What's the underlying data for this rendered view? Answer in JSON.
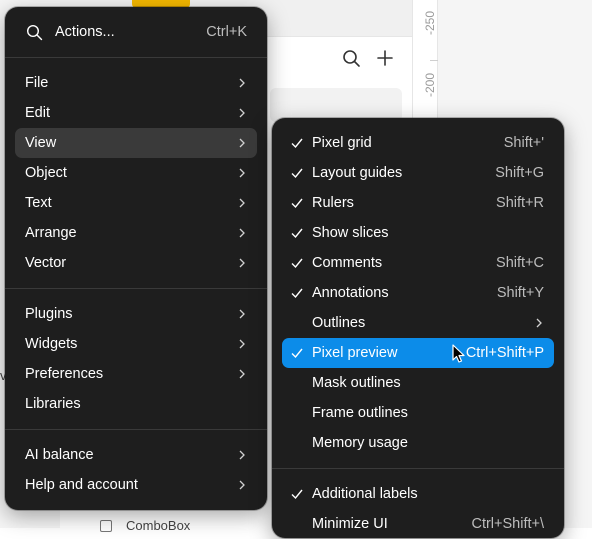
{
  "background": {
    "ruler_labels": [
      "-250",
      "-200"
    ],
    "bottom_item": "ComboBox",
    "partial_text": "v"
  },
  "main_menu": {
    "search": {
      "label": "Actions...",
      "shortcut": "Ctrl+K",
      "icon": "search-icon"
    },
    "group1": [
      {
        "label": "File",
        "submenu": true
      },
      {
        "label": "Edit",
        "submenu": true
      },
      {
        "label": "View",
        "submenu": true,
        "highlighted": true
      },
      {
        "label": "Object",
        "submenu": true
      },
      {
        "label": "Text",
        "submenu": true
      },
      {
        "label": "Arrange",
        "submenu": true
      },
      {
        "label": "Vector",
        "submenu": true
      }
    ],
    "group2": [
      {
        "label": "Plugins",
        "submenu": true
      },
      {
        "label": "Widgets",
        "submenu": true
      },
      {
        "label": "Preferences",
        "submenu": true
      },
      {
        "label": "Libraries",
        "submenu": false
      }
    ],
    "group3": [
      {
        "label": "AI balance",
        "submenu": true
      },
      {
        "label": "Help and account",
        "submenu": true
      }
    ]
  },
  "view_submenu": {
    "group1": [
      {
        "label": "Pixel grid",
        "shortcut": "Shift+'",
        "checked": true
      },
      {
        "label": "Layout guides",
        "shortcut": "Shift+G",
        "checked": true
      },
      {
        "label": "Rulers",
        "shortcut": "Shift+R",
        "checked": true
      },
      {
        "label": "Show slices",
        "shortcut": "",
        "checked": true
      },
      {
        "label": "Comments",
        "shortcut": "Shift+C",
        "checked": true
      },
      {
        "label": "Annotations",
        "shortcut": "Shift+Y",
        "checked": true
      },
      {
        "label": "Outlines",
        "shortcut": "",
        "checked": false,
        "submenu": true
      },
      {
        "label": "Pixel preview",
        "shortcut": "Ctrl+Shift+P",
        "checked": true,
        "active": true
      },
      {
        "label": "Mask outlines",
        "shortcut": "",
        "checked": false
      },
      {
        "label": "Frame outlines",
        "shortcut": "",
        "checked": false
      },
      {
        "label": "Memory usage",
        "shortcut": "",
        "checked": false
      }
    ],
    "group2": [
      {
        "label": "Additional labels",
        "shortcut": "",
        "checked": true
      },
      {
        "label": "Minimize UI",
        "shortcut": "Ctrl+Shift+\\",
        "checked": false
      }
    ]
  },
  "colors": {
    "menu_bg": "#1e1e1e",
    "hover_bg": "#3a3a3a",
    "active_bg": "#0c8ce9",
    "accent_tag": "#f5b800"
  }
}
